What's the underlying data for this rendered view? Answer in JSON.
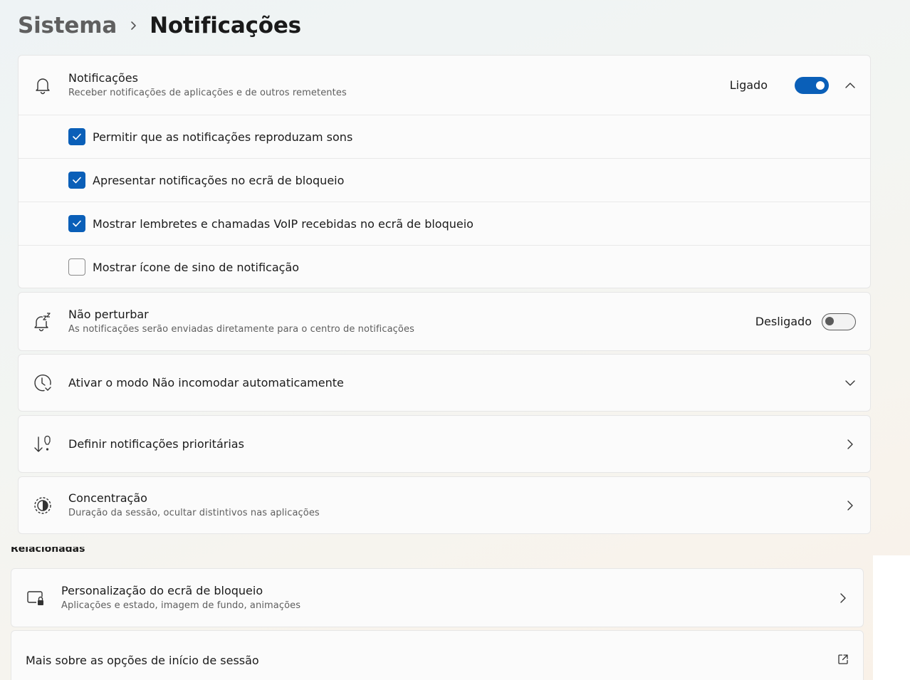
{
  "breadcrumb": {
    "parent": "Sistema",
    "current": "Notificações"
  },
  "notifications": {
    "title": "Notificações",
    "subtitle": "Receber notificações de aplicações e de outros remetentes",
    "state": "Ligado",
    "options": [
      {
        "label": "Permitir que as notificações reproduzam sons",
        "checked": true
      },
      {
        "label": "Apresentar notificações no ecrã de bloqueio",
        "checked": true
      },
      {
        "label": "Mostrar lembretes e chamadas VoIP recebidas no ecrã de bloqueio",
        "checked": true
      },
      {
        "label": "Mostrar ícone de sino de notificação",
        "checked": false
      }
    ]
  },
  "dnd": {
    "title": "Não perturbar",
    "subtitle": "As notificações serão enviadas diretamente para o centro de notificações",
    "state": "Desligado"
  },
  "auto_dnd": {
    "title": "Ativar o modo Não incomodar automaticamente"
  },
  "priority": {
    "title": "Definir notificações prioritárias"
  },
  "focus": {
    "title": "Concentração",
    "subtitle": "Duração da sessão, ocultar distintivos nas aplicações"
  },
  "related": {
    "section_title": "Relacionadas",
    "lock_screen": {
      "title": "Personalização do ecrã de bloqueio",
      "subtitle": "Aplicações e estado, imagem de fundo, animações"
    },
    "signin_link": "Mais sobre as opções de início de sessão"
  },
  "colors": {
    "accent": "#0a5fb8"
  }
}
